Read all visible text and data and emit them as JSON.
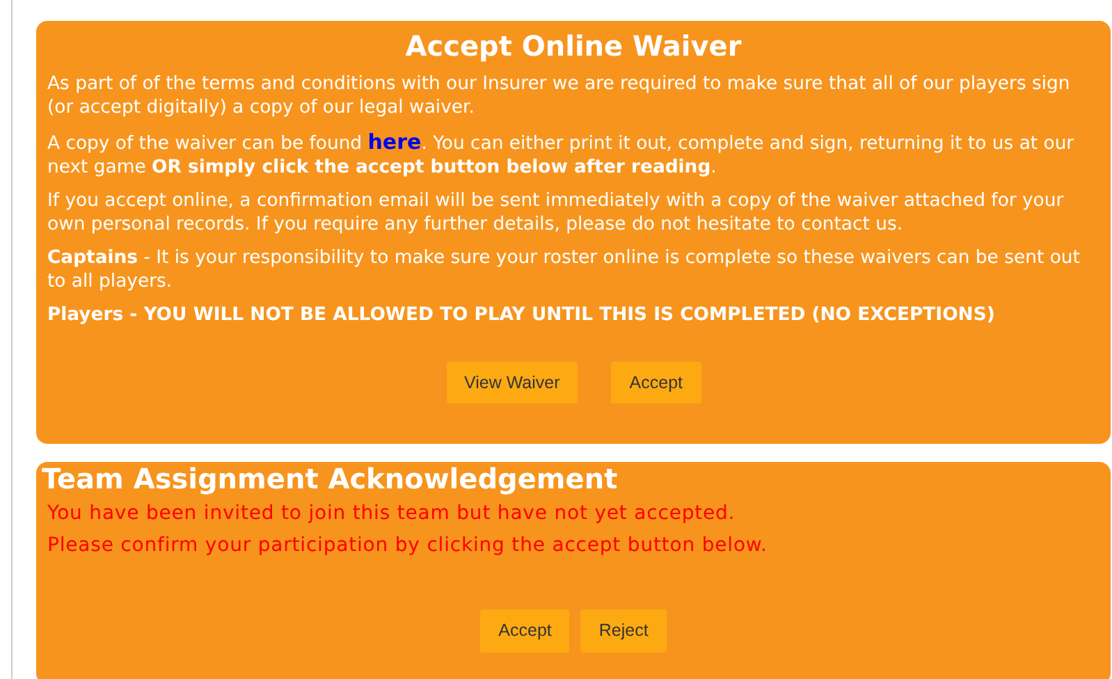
{
  "waiver": {
    "title": "Accept Online Waiver",
    "paragraphs": [
      {
        "text": "As part of of the terms and conditions with our Insurer we are required to make sure that all of our players sign (or accept digitally) a copy of our legal waiver."
      },
      {
        "text": "A copy of the waiver can be found ",
        "link": "here",
        "after": ". You can either print it out, complete and sign, returning it to us at our next game **OR simply click the accept button below after reading**."
      },
      {
        "text": "If you accept online, a confirmation email will be sent immediately with a copy of the waiver attached for your own personal records. If you require any further details, please do not hesitate to contact us."
      },
      {
        "text": "**Captains** - It is your responsibility to make sure your roster online is complete so these waivers can be sent out to all players."
      },
      {
        "text": "**Players - YOU WILL NOT BE ALLOWED TO PLAY UNTIL THIS IS COMPLETED (NO EXCEPTIONS)**"
      }
    ],
    "buttons": [
      "View Waiver",
      "Accept"
    ]
  },
  "team": {
    "title": "Team Assignment Acknowledgement",
    "messages": [
      "You have been invited to join this team but have not yet accepted.",
      "Please confirm your participation by clicking the accept button below."
    ],
    "buttons": [
      "Accept",
      "Reject"
    ]
  }
}
